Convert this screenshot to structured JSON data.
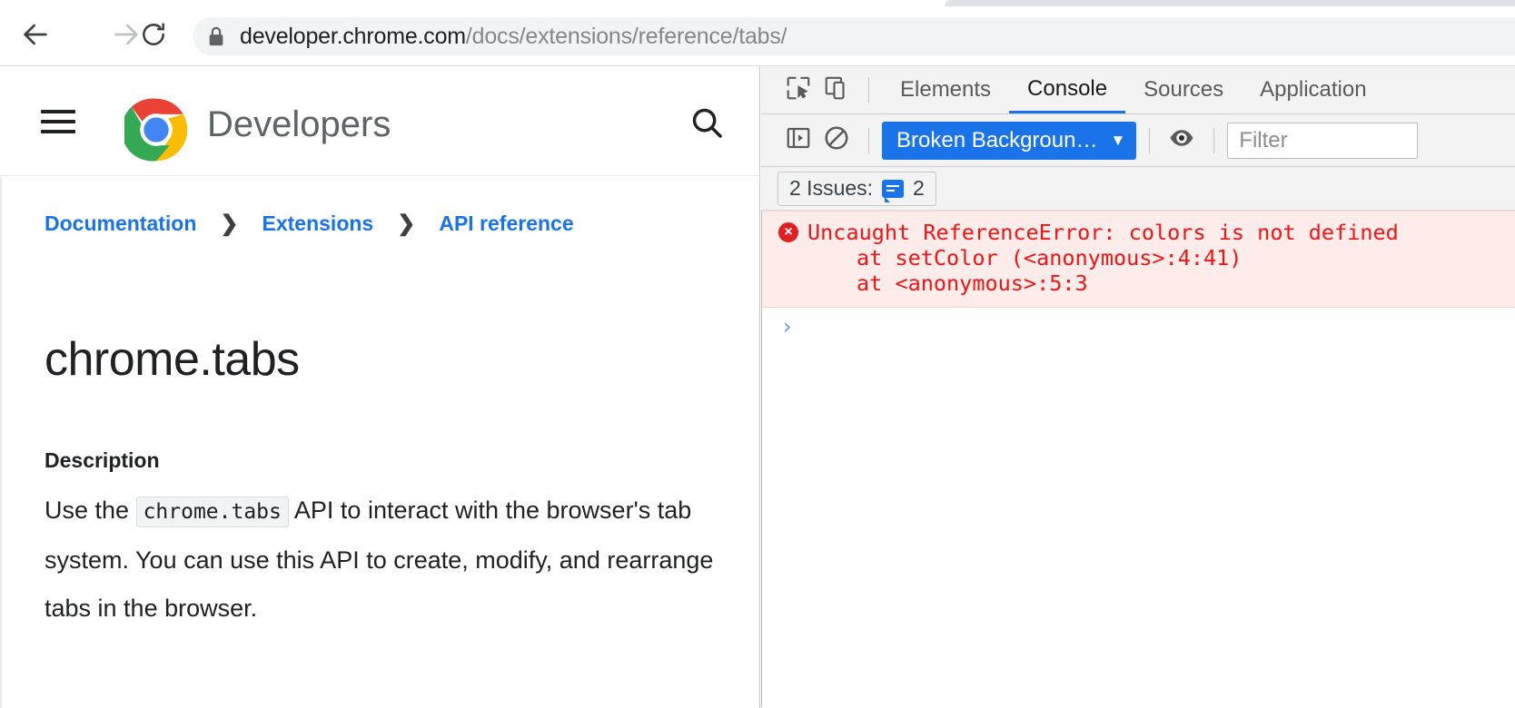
{
  "browser": {
    "nav": {
      "back_icon": "arrow-left-icon",
      "forward_icon": "arrow-right-icon",
      "reload_icon": "reload-icon"
    },
    "omnibox": {
      "lock_icon": "lock-icon",
      "url_host": "developer.chrome.com",
      "url_path": "/docs/extensions/reference/tabs/",
      "full_url": "developer.chrome.com/docs/extensions/reference/tabs/"
    }
  },
  "site_header": {
    "menu_icon": "hamburger-menu-icon",
    "logo_icon": "chrome-logo-icon",
    "brand": "Developers",
    "search_icon": "search-icon"
  },
  "page": {
    "breadcrumb": [
      {
        "label": "Documentation"
      },
      {
        "label": "Extensions"
      },
      {
        "label": "API reference"
      }
    ],
    "breadcrumb_separator": "❯",
    "title": "chrome.tabs",
    "section_label": "Description",
    "description": {
      "before_code": "Use the ",
      "code": "chrome.tabs",
      "after_code": " API to interact with the browser's tab system. You can use this API to create, modify, and rearrange tabs in the browser."
    }
  },
  "devtools": {
    "left_icons": [
      {
        "name": "inspect-element-icon"
      },
      {
        "name": "device-toolbar-icon"
      }
    ],
    "tabs": [
      {
        "label": "Elements",
        "active": false
      },
      {
        "label": "Console",
        "active": true
      },
      {
        "label": "Sources",
        "active": false
      },
      {
        "label": "Application",
        "active": false
      }
    ],
    "toolbar": {
      "sidebar_icon": "console-sidebar-toggle-icon",
      "clear_icon": "clear-console-icon",
      "context_value": "Broken Backgroun…",
      "context_caret": "▼",
      "eye_icon": "live-expression-eye-icon",
      "filter_placeholder": "Filter"
    },
    "issues": {
      "label": "2 Issues:",
      "badge_icon": "issues-message-icon",
      "count": "2"
    },
    "console": {
      "error": {
        "icon": "error-circle-icon",
        "icon_glyph": "×",
        "lines": [
          "Uncaught ReferenceError: colors is not defined",
          "at setColor (<anonymous>:4:41)",
          "at <anonymous>:5:3"
        ]
      },
      "prompt_caret": "›"
    }
  },
  "colors": {
    "accent_blue": "#1a73e8",
    "error_red": "#f01414",
    "error_bg": "#fdecea",
    "link_blue": "#1a73e8",
    "toolbar_grey": "#f3f3f3",
    "omnibox_grey": "#f1f3f4"
  }
}
